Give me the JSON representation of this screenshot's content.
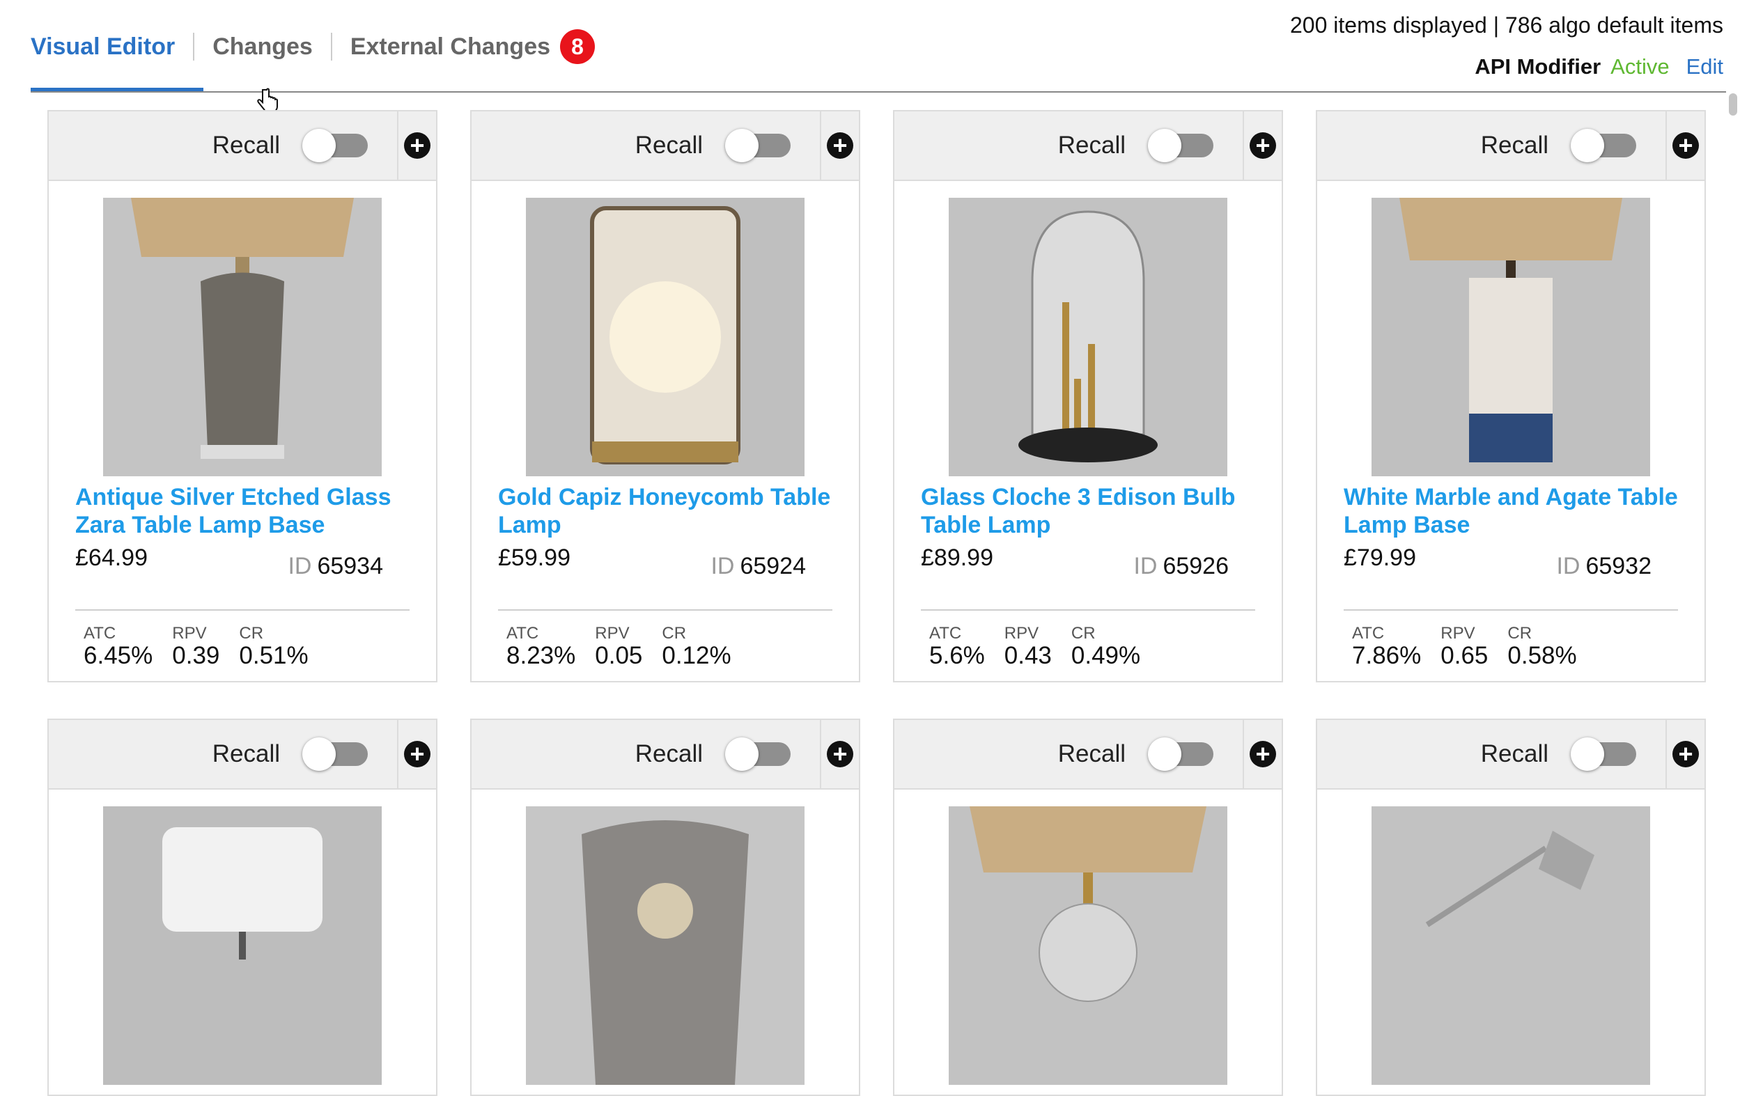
{
  "tabs": [
    {
      "label": "Visual Editor"
    },
    {
      "label": "Changes"
    },
    {
      "label": "External Changes",
      "badge": "8"
    }
  ],
  "header": {
    "counts_text": "200 items displayed | 786 algo default items",
    "api_label": "API Modifier",
    "api_status": "Active",
    "edit_label": "Edit"
  },
  "colors": {
    "accent": "#2a72c5",
    "link": "#1e9be8",
    "active": "#5fb832",
    "badge": "#e8141b"
  },
  "recall_label": "Recall",
  "products": [
    {
      "name": "Antique Silver Etched Glass Zara Table Lamp Base",
      "price": "£64.99",
      "id_label": "ID",
      "id": "65934",
      "metrics": [
        {
          "label": "ATC",
          "value": "6.45%"
        },
        {
          "label": "RPV",
          "value": "0.39"
        },
        {
          "label": "CR",
          "value": "0.51%"
        }
      ]
    },
    {
      "name": "Gold Capiz Honeycomb Table Lamp",
      "price": "£59.99",
      "id_label": "ID",
      "id": "65924",
      "metrics": [
        {
          "label": "ATC",
          "value": "8.23%"
        },
        {
          "label": "RPV",
          "value": "0.05"
        },
        {
          "label": "CR",
          "value": "0.12%"
        }
      ]
    },
    {
      "name": "Glass Cloche 3 Edison Bulb Table Lamp",
      "price": "£89.99",
      "id_label": "ID",
      "id": "65926",
      "metrics": [
        {
          "label": "ATC",
          "value": "5.6%"
        },
        {
          "label": "RPV",
          "value": "0.43"
        },
        {
          "label": "CR",
          "value": "0.49%"
        }
      ]
    },
    {
      "name": "White Marble and Agate Table Lamp Base",
      "price": "£79.99",
      "id_label": "ID",
      "id": "65932",
      "metrics": [
        {
          "label": "ATC",
          "value": "7.86%"
        },
        {
          "label": "RPV",
          "value": "0.65"
        },
        {
          "label": "CR",
          "value": "0.58%"
        }
      ]
    }
  ]
}
